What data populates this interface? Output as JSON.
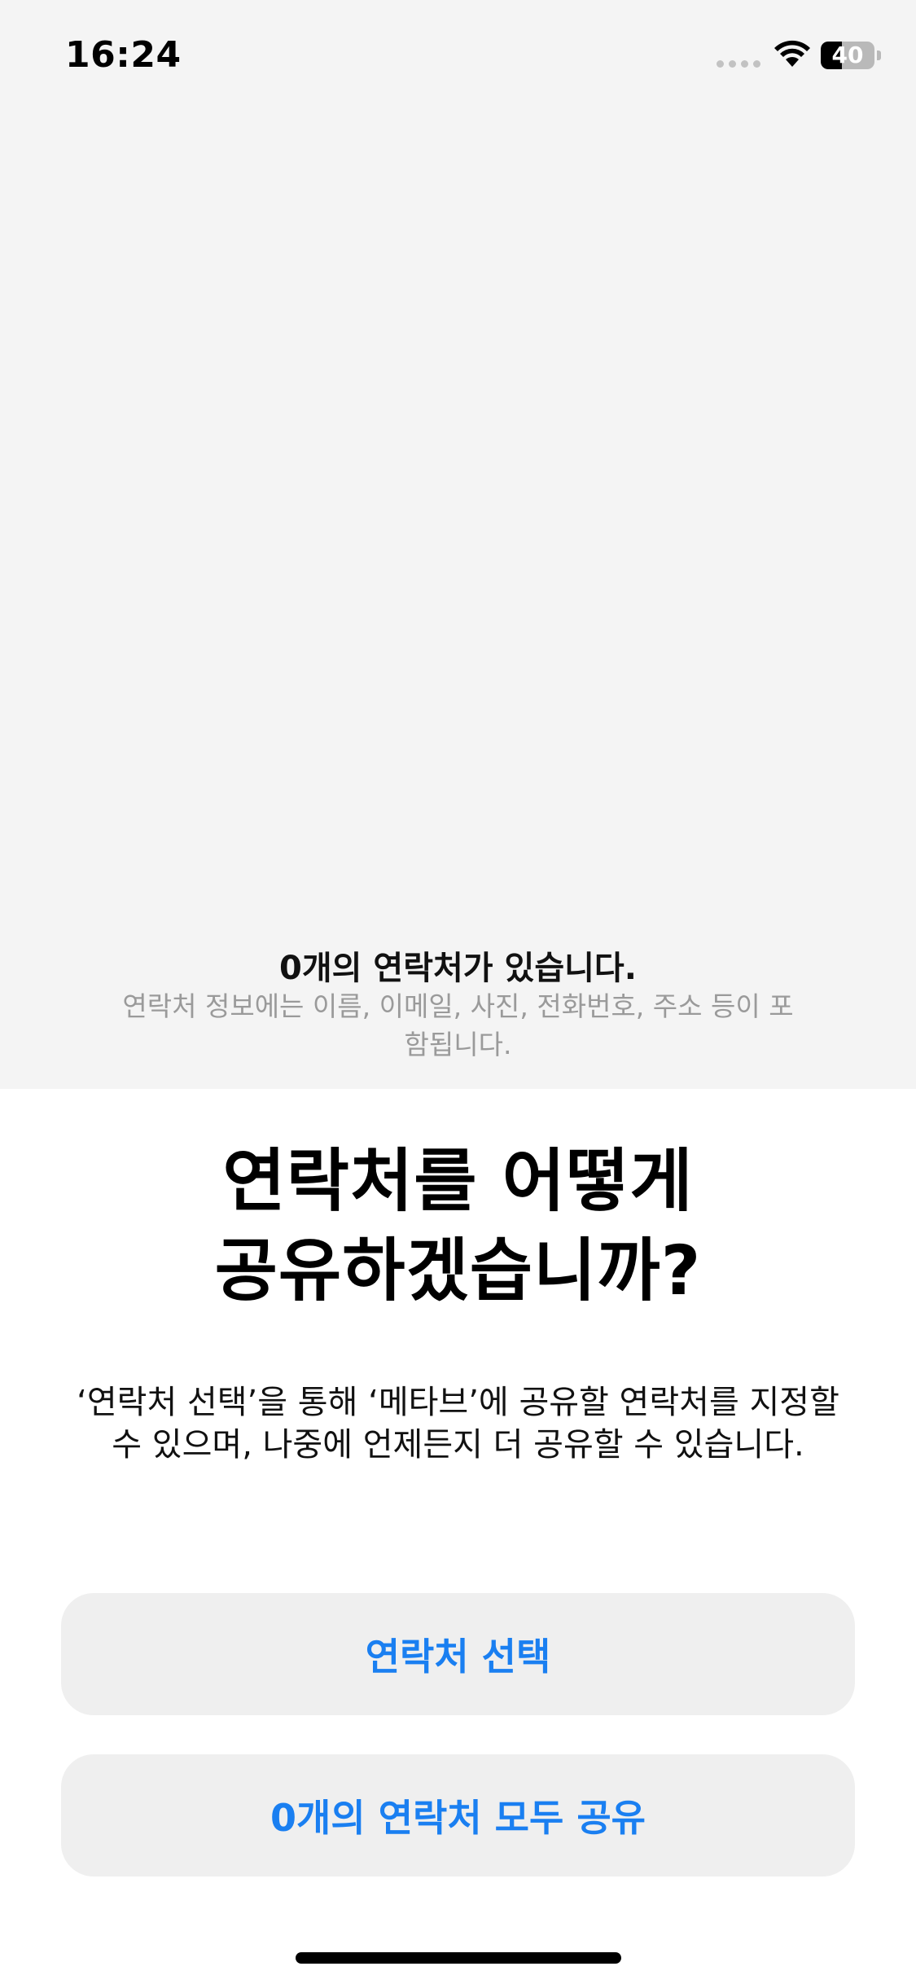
{
  "status_bar": {
    "time": "16:24",
    "battery_level": "40",
    "battery_fraction": 0.4
  },
  "contacts_summary": {
    "count_text": "0개의 연락처가 있습니다.",
    "info_text": "연락처 정보에는 이름, 이메일, 사진, 전화번호, 주소 등이 포함됩니다."
  },
  "sheet": {
    "title_line1": "연락처를 어떻게",
    "title_line2": "공유하겠습니까?",
    "description": "‘연락처 선택’을 통해 ‘메타브’에 공유할 연락처를 지정할 수 있으며, 나중에 언제든지 더 공유할 수 있습니다.",
    "select_button_label": "연락처 선택",
    "share_all_button_label": "0개의 연락처 모두 공유"
  },
  "colors": {
    "accent": "#1a7ff1",
    "top_background": "#f4f4f4",
    "button_background": "#efefef"
  },
  "icons": [
    "wifi-icon",
    "battery-icon",
    "signal-dots-icon"
  ]
}
